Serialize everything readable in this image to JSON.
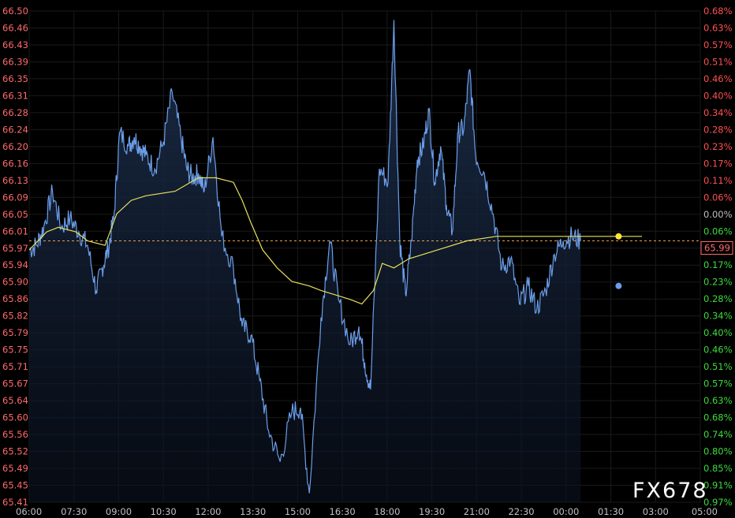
{
  "chart_data": {
    "type": "line",
    "watermark": "FX678",
    "colors": {
      "background": "#000000",
      "price_line": "#6b9eea",
      "price_fill_top": "#1c2e4a",
      "average_line": "#e8e05a",
      "axis_text": "#c0c0c0",
      "left_axis_text": "#ff6a6a",
      "up_percent": "#ff5050",
      "down_percent": "#3ddc3d",
      "flat_percent": "#c0c0c0",
      "last_price_box": "#ff6a6a"
    },
    "x_ticks": [
      "06:00",
      "07:30",
      "09:00",
      "10:30",
      "12:00",
      "13:30",
      "15:00",
      "16:30",
      "18:00",
      "19:30",
      "21:00",
      "22:30",
      "00:00",
      "01:30",
      "03:00",
      "05:00"
    ],
    "y_left_ticks": [
      "66.50",
      "66.46",
      "66.43",
      "66.39",
      "66.35",
      "66.31",
      "66.28",
      "66.24",
      "66.20",
      "66.16",
      "66.13",
      "66.09",
      "66.05",
      "66.01",
      "65.97",
      "65.94",
      "65.90",
      "65.86",
      "65.82",
      "65.79",
      "65.75",
      "65.71",
      "65.67",
      "65.64",
      "65.60",
      "65.56",
      "65.52",
      "65.49",
      "65.45",
      "65.41"
    ],
    "y_right_ticks": [
      "0.68%",
      "0.63%",
      "0.57%",
      "0.51%",
      "0.46%",
      "0.40%",
      "0.34%",
      "0.28%",
      "0.23%",
      "0.17%",
      "0.11%",
      "0.06%",
      "0.00%",
      "0.06%",
      "0.11%",
      "0.17%",
      "0.23%",
      "0.28%",
      "0.34%",
      "0.40%",
      "0.46%",
      "0.51%",
      "0.57%",
      "0.63%",
      "0.68%",
      "0.74%",
      "0.80%",
      "0.85%",
      "0.91%",
      "0.97%"
    ],
    "ylim": [
      65.41,
      66.5
    ],
    "reference_price": 66.05,
    "last_price": "65.99",
    "last_price_value": 65.99,
    "x_range_hours": [
      0,
      23
    ],
    "price_series": {
      "x": [
        0,
        0.25,
        0.5,
        0.8,
        1.1,
        1.4,
        1.7,
        2.0,
        2.3,
        2.5,
        2.7,
        2.9,
        3.1,
        3.4,
        3.6,
        3.8,
        4.0,
        4.3,
        4.6,
        4.9,
        5.2,
        5.4,
        5.6,
        5.8,
        6.0,
        6.3,
        6.6,
        7.0,
        7.3,
        7.6,
        7.9,
        8.2,
        8.6,
        9.0,
        9.3,
        9.6,
        10.0,
        10.3,
        10.6,
        11.0,
        11.3,
        11.5,
        11.7,
        12.0,
        12.3,
        12.5,
        12.7,
        12.9,
        13.1,
        13.3,
        13.5,
        13.7,
        13.9,
        14.1,
        14.3,
        14.5,
        14.7,
        14.9,
        15.1,
        15.3,
        15.6,
        15.9,
        16.2,
        16.5,
        16.8,
        17.1,
        17.4,
        17.7,
        18.0,
        18.3,
        18.6,
        18.9,
        19.2,
        19.5,
        19.8,
        20.1,
        20.4,
        20.7,
        21.0,
        21.3,
        21.6,
        21.9,
        22.2,
        22.5,
        22.8,
        23.0
      ],
      "y": [
        65.97,
        65.98,
        66.02,
        66.1,
        66.02,
        66.04,
        66.01,
        65.98,
        65.88,
        65.93,
        65.97,
        66.04,
        66.23,
        66.2,
        66.22,
        66.2,
        66.18,
        66.15,
        66.21,
        66.32,
        66.22,
        66.15,
        66.13,
        66.14,
        66.1,
        66.22,
        66.0,
        65.93,
        65.8,
        65.78,
        65.68,
        65.57,
        65.5,
        65.61,
        65.62,
        65.43,
        65.82,
        65.99,
        65.86,
        65.76,
        65.8,
        65.72,
        65.66,
        66.15,
        66.12,
        66.48,
        65.99,
        65.87,
        65.99,
        66.17,
        66.2,
        66.28,
        66.12,
        66.2,
        66.07,
        66.01,
        66.23,
        66.24,
        66.37,
        66.18,
        66.14,
        66.05,
        65.93,
        65.95,
        65.85,
        65.89,
        65.84,
        65.88,
        65.96,
        65.99,
        66.0,
        65.99
      ],
      "x_note": "hours since 06:00"
    },
    "average_series": {
      "x": [
        0,
        0.6,
        1.0,
        1.6,
        2.0,
        2.6,
        3.0,
        3.5,
        4.0,
        5.0,
        5.8,
        6.4,
        7.0,
        7.3,
        7.6,
        8.0,
        8.5,
        9.0,
        9.6,
        10.0,
        10.5,
        11.0,
        11.4,
        11.8,
        12.1,
        12.5,
        13.0,
        14.0,
        15.0,
        16.0,
        17.0,
        18.0,
        19.0,
        19.5,
        20.0,
        20.5,
        21.0
      ],
      "y": [
        65.97,
        66.01,
        66.02,
        66.01,
        65.99,
        65.98,
        66.05,
        66.08,
        66.09,
        66.1,
        66.13,
        66.13,
        66.12,
        66.08,
        66.03,
        65.97,
        65.93,
        65.9,
        65.89,
        65.88,
        65.87,
        65.86,
        65.85,
        65.88,
        65.94,
        65.93,
        65.95,
        65.97,
        65.99,
        66.0,
        66.0,
        66.0,
        66.0,
        66.0,
        66.0,
        66.0,
        66.0
      ]
    },
    "markers": [
      {
        "series": "average",
        "x": 20.2,
        "y": 66.0,
        "color": "#ffe83a"
      },
      {
        "series": "price",
        "x": 20.2,
        "y": 65.89,
        "color": "#6b9eea"
      }
    ]
  }
}
